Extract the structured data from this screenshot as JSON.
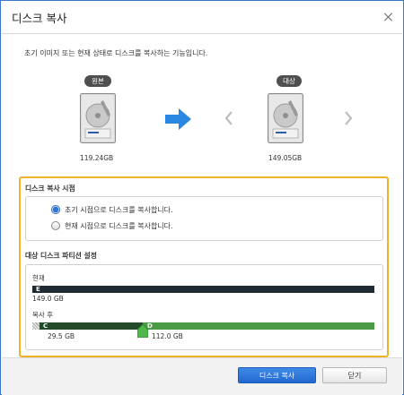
{
  "dialog": {
    "title": "디스크 복사",
    "description": "초기 이미지 또는 현재 상태로 디스크를 복사하는 기능입니다."
  },
  "source": {
    "badge": "원본",
    "size": "119.24GB"
  },
  "target": {
    "badge": "대상",
    "size": "149.05GB"
  },
  "copy_point": {
    "title": "디스크 복사 시점",
    "options": [
      {
        "label": "초기 시점으로 디스크를 복사합니다.",
        "selected": true
      },
      {
        "label": "현재 시점으로 디스크를 복사합니다.",
        "selected": false
      }
    ]
  },
  "partition": {
    "title": "대상 디스크 파티션 설정",
    "current_label": "현재",
    "current_partition": {
      "letter": "E",
      "size": "149.0 GB"
    },
    "after_label": "복사 후",
    "after_partitions": [
      {
        "letter": "C",
        "size": "29.5 GB"
      },
      {
        "letter": "D",
        "size": "112.0 GB"
      }
    ]
  },
  "footer": {
    "copy_button": "디스크 복사",
    "close_button": "닫기"
  },
  "colors": {
    "accent": "#2f78e0",
    "highlight_border": "#f0b229",
    "bar_dark": "#1f2a33",
    "bar_c": "#234a2a",
    "bar_d": "#4a9a46"
  },
  "icons": [
    "close-icon",
    "hard-drive-icon",
    "arrow-right-icon",
    "chevron-left-icon",
    "chevron-right-icon",
    "radio-icon",
    "slider-handle-icon"
  ]
}
